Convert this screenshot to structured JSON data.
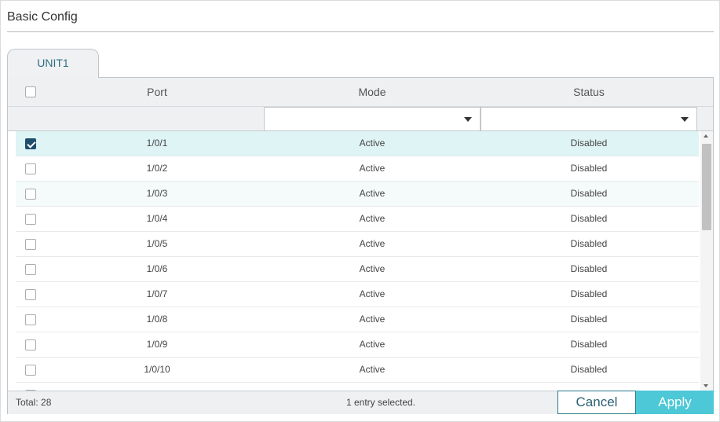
{
  "section": {
    "title": "Basic Config"
  },
  "tabs": [
    {
      "label": "UNIT1",
      "active": true
    }
  ],
  "table": {
    "columns": [
      "Port",
      "Mode",
      "Status"
    ],
    "mode_filter": "",
    "status_filter": "",
    "rows": [
      {
        "port": "1/0/1",
        "mode": "Active",
        "status": "Disabled",
        "checked": true
      },
      {
        "port": "1/0/2",
        "mode": "Active",
        "status": "Disabled",
        "checked": false
      },
      {
        "port": "1/0/3",
        "mode": "Active",
        "status": "Disabled",
        "checked": false
      },
      {
        "port": "1/0/4",
        "mode": "Active",
        "status": "Disabled",
        "checked": false
      },
      {
        "port": "1/0/5",
        "mode": "Active",
        "status": "Disabled",
        "checked": false
      },
      {
        "port": "1/0/6",
        "mode": "Active",
        "status": "Disabled",
        "checked": false
      },
      {
        "port": "1/0/7",
        "mode": "Active",
        "status": "Disabled",
        "checked": false
      },
      {
        "port": "1/0/8",
        "mode": "Active",
        "status": "Disabled",
        "checked": false
      },
      {
        "port": "1/0/9",
        "mode": "Active",
        "status": "Disabled",
        "checked": false
      },
      {
        "port": "1/0/10",
        "mode": "Active",
        "status": "Disabled",
        "checked": false
      }
    ]
  },
  "footer": {
    "total": "Total: 28",
    "selected": "1 entry selected.",
    "cancel_label": "Cancel",
    "apply_label": "Apply"
  },
  "colors": {
    "accent": "#4cc8d6",
    "selected_row": "#dff4f4",
    "checkbox_checked": "#1f4e6b"
  }
}
